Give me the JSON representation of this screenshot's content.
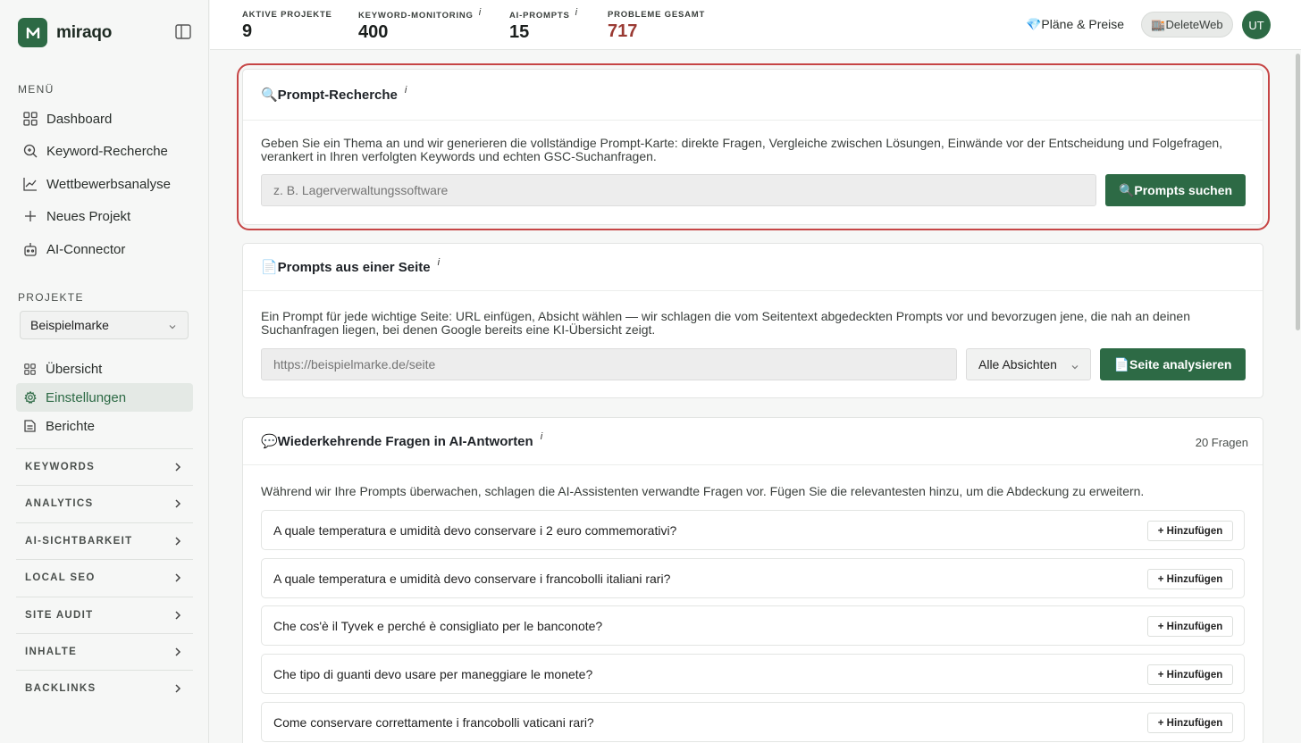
{
  "brand": {
    "name": "miraqo"
  },
  "sidebar": {
    "menu_label": "MENÜ",
    "menu": [
      {
        "label": "Dashboard",
        "icon": "grid-icon"
      },
      {
        "label": "Keyword-Recherche",
        "icon": "search-icon"
      },
      {
        "label": "Wettbewerbsanalyse",
        "icon": "line-chart-icon"
      },
      {
        "label": "Neues Projekt",
        "icon": "plus-icon"
      },
      {
        "label": "AI-Connector",
        "icon": "robot-icon"
      }
    ],
    "projects_label": "PROJEKTE",
    "project_selected": "Beispielmarke",
    "project_items": [
      {
        "label": "Übersicht",
        "icon": "grid-icon"
      },
      {
        "label": "Einstellungen",
        "icon": "gear-icon",
        "active": true
      },
      {
        "label": "Berichte",
        "icon": "document-icon"
      }
    ],
    "groups": [
      "KEYWORDS",
      "ANALYTICS",
      "AI-SICHTBARKEIT",
      "LOCAL SEO",
      "SITE AUDIT",
      "INHALTE",
      "BACKLINKS"
    ]
  },
  "topbar": {
    "stats": [
      {
        "label": "AKTIVE PROJEKTE",
        "value": "9",
        "info": ""
      },
      {
        "label": "KEYWORD-MONITORING",
        "value": "400",
        "info": "i"
      },
      {
        "label": "AI-PROMPTS",
        "value": "15",
        "info": "i"
      },
      {
        "label": "PROBLEME GESAMT",
        "value": "717",
        "info": ""
      }
    ],
    "plans_label": "💎Pläne & Preise",
    "account_label": "🏬DeleteWeb",
    "avatar_initials": "UT"
  },
  "prompt_research": {
    "title": "🔍Prompt-Recherche",
    "info": "i",
    "description": "Geben Sie ein Thema an und wir generieren die vollständige Prompt-Karte: direkte Fragen, Vergleiche zwischen Lösungen, Einwände vor der Entscheidung und Folgefragen, verankert in Ihren verfolgten Keywords und echten GSC-Suchanfragen.",
    "input_placeholder": "z. B. Lagerverwaltungssoftware",
    "button_label": "🔍Prompts suchen"
  },
  "page_prompts": {
    "title": "📄Prompts aus einer Seite",
    "info": "i",
    "description": "Ein Prompt für jede wichtige Seite: URL einfügen, Absicht wählen — wir schlagen die vom Seitentext abgedeckten Prompts vor und bevorzugen jene, die nah an deinen Suchanfragen liegen, bei denen Google bereits eine KI-Übersicht zeigt.",
    "input_placeholder": "https://beispielmarke.de/seite",
    "select_value": "Alle Absichten",
    "button_label": "📄Seite analysieren"
  },
  "recurring_questions": {
    "title": "💬Wiederkehrende Fragen in AI-Antworten",
    "info": "i",
    "count": "20 Fragen",
    "description": "Während wir Ihre Prompts überwachen, schlagen die AI-Assistenten verwandte Fragen vor. Fügen Sie die relevantesten hinzu, um die Abdeckung zu erweitern.",
    "add_label": "+ Hinzufügen",
    "questions": [
      "A quale temperatura e umidità devo conservare i 2 euro commemorativi?",
      "A quale temperatura e umidità devo conservare i francobolli italiani rari?",
      "Che cos'è il Tyvek e perché è consigliato per le banconote?",
      "Che tipo di guanti devo usare per maneggiare le monete?",
      "Come conservare correttamente i francobolli vaticani rari?"
    ]
  }
}
